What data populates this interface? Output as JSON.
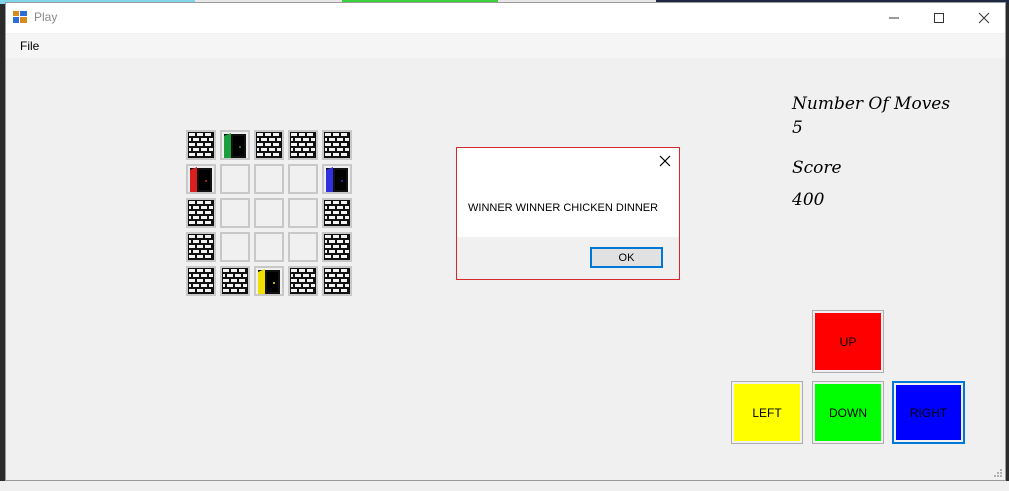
{
  "window": {
    "title": "Play",
    "menu": {
      "file_label": "File"
    }
  },
  "board": {
    "rows": [
      [
        "wall",
        "door-green",
        "wall",
        "wall",
        "wall"
      ],
      [
        "door-red",
        "empty",
        "empty",
        "empty",
        "door-blue"
      ],
      [
        "wall",
        "empty",
        "empty",
        "empty",
        "wall"
      ],
      [
        "wall",
        "empty",
        "empty",
        "empty",
        "wall"
      ],
      [
        "wall",
        "wall",
        "door-yellow",
        "wall",
        "wall"
      ]
    ],
    "colors": {
      "door-green": "#1e9e3c",
      "door-red": "#d82020",
      "door-blue": "#3030e0",
      "door-yellow": "#f0e000"
    }
  },
  "stats": {
    "moves_label": "Number Of Moves",
    "moves_value": "5",
    "score_label": "Score",
    "score_value": "400"
  },
  "controls": {
    "up": {
      "label": "UP",
      "color": "#ff0000"
    },
    "left": {
      "label": "LEFT",
      "color": "#ffff00"
    },
    "down": {
      "label": "DOWN",
      "color": "#00ff00"
    },
    "right": {
      "label": "RIGHT",
      "color": "#0000ff"
    }
  },
  "dialog": {
    "message": "WINNER WINNER CHICKEN DINNER",
    "ok_label": "OK"
  }
}
